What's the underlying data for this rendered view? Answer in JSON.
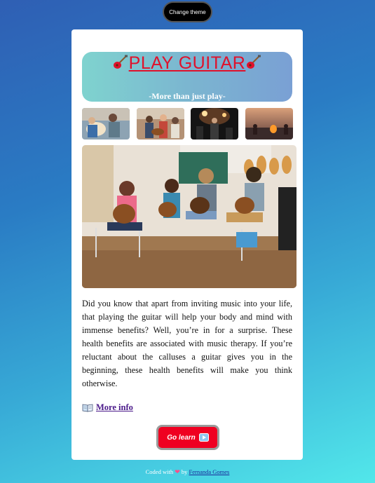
{
  "theme_button": {
    "label": "Change theme"
  },
  "banner": {
    "title": "PLAY GUITAR",
    "subtitle": "-More than just play-",
    "icon": "guitar-icon"
  },
  "gallery": {
    "thumbnails": [
      "guitar-lesson-thumb",
      "friends-guitar-thumb",
      "concert-thumb",
      "campfire-thumb"
    ],
    "main_image": "guitar-class-photo"
  },
  "article": {
    "text": "Did you know that apart from inviting music into your life, that playing the guitar will help your body and mind with immense benefits? Well, you’re in for a surprise. These health benefits are associated with music therapy. If you’re reluctant about the calluses a guitar gives you in the beginning, these health benefits will make you think otherwise."
  },
  "more_info": {
    "icon": "book-icon",
    "label": "More info"
  },
  "cta": {
    "label": "Go learn",
    "icon": "play-icon"
  },
  "footer": {
    "prefix": "Coded with",
    "by": "by",
    "author": "Fernanda Gomes"
  },
  "colors": {
    "accent": "#e0112b",
    "button": "#ef0021",
    "link": "#4b1a8a"
  }
}
